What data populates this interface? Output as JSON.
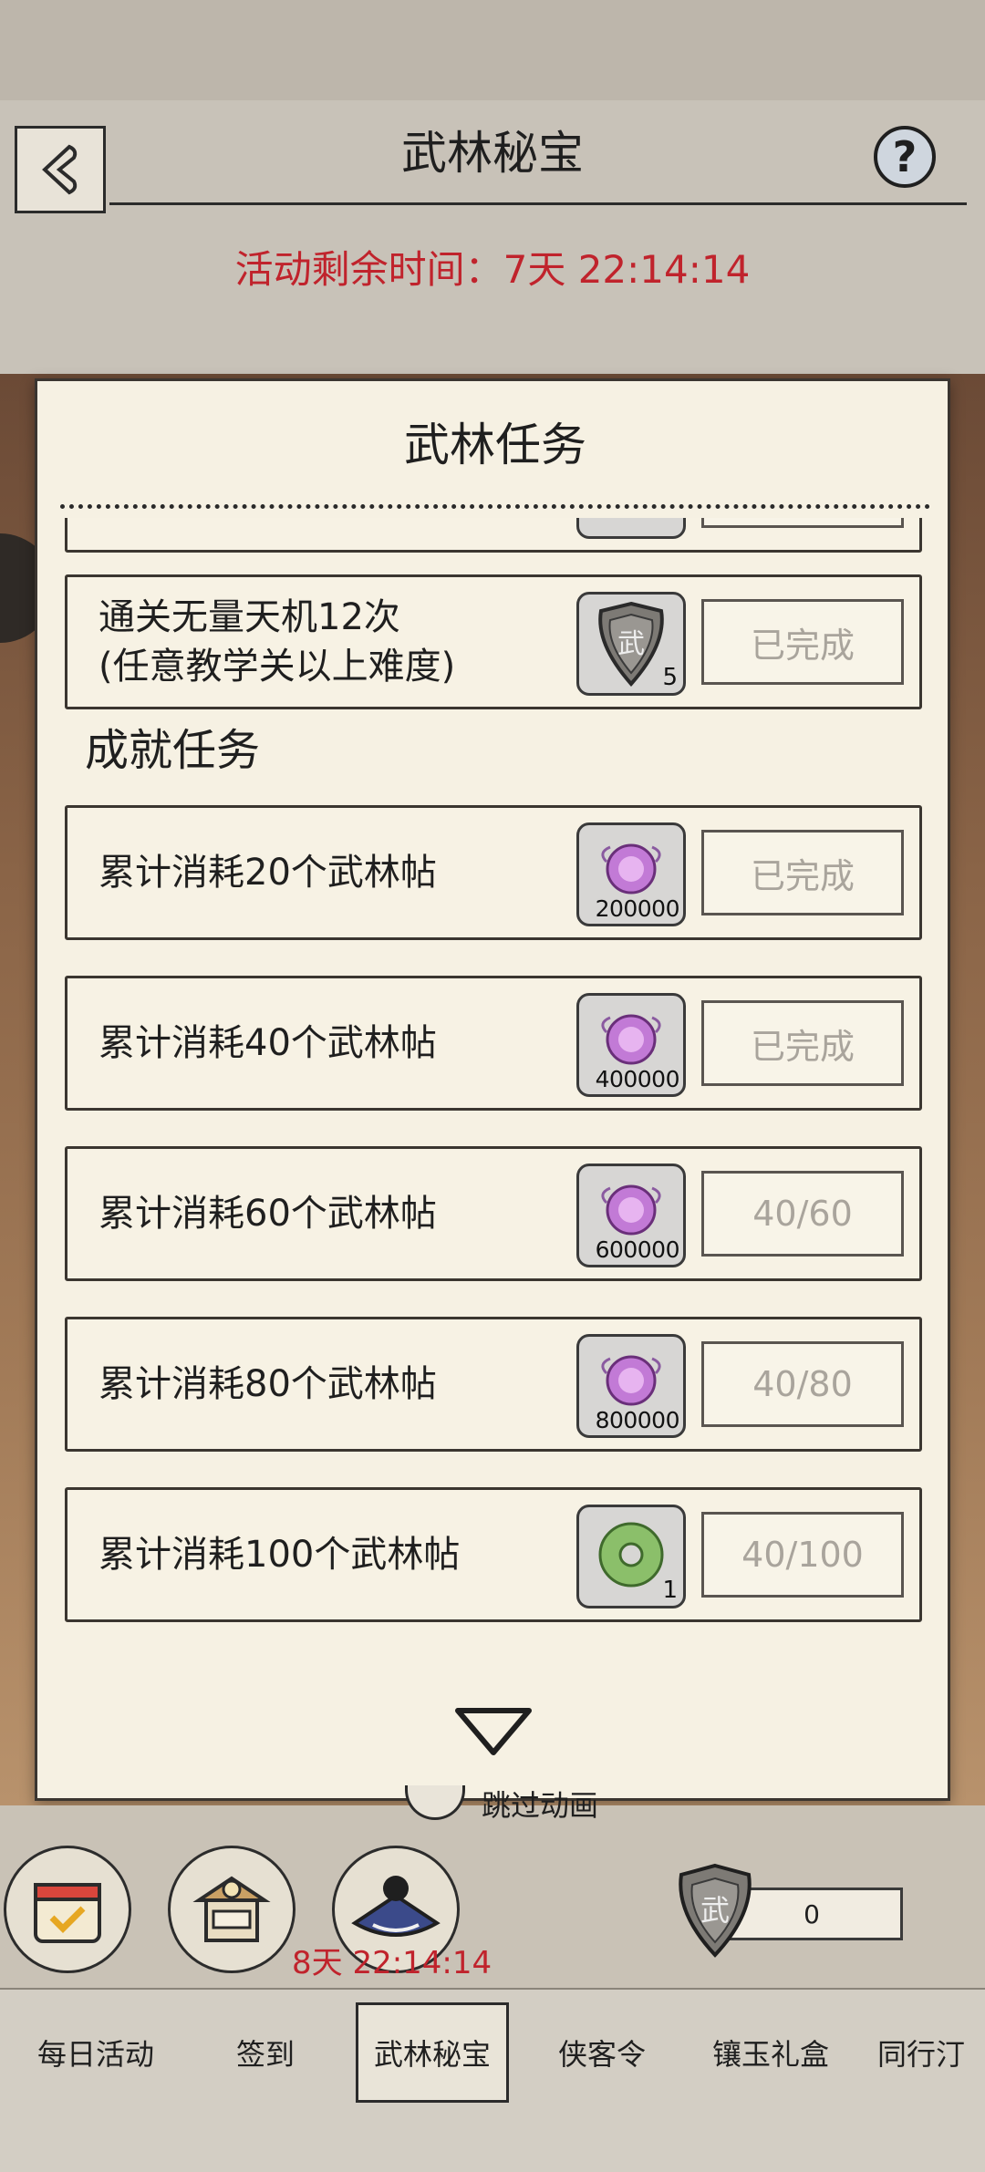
{
  "header": {
    "title": "武林秘宝",
    "timer_text": "活动剩余时间：7天 22:14:14",
    "help_label": "?"
  },
  "panel": {
    "title": "武林任务",
    "daily_tasks": [
      {
        "desc_line1": "通关无量天机12次",
        "desc_line2": "(任意教学关以上难度)",
        "reward_icon": "wu-shield-token",
        "reward_count": "5",
        "status": "已完成"
      }
    ],
    "achievement_section_title": "成就任务",
    "achievement_tasks": [
      {
        "desc": "累计消耗20个武林帖",
        "reward_icon": "purple-orb",
        "reward_count": "200000",
        "status": "已完成"
      },
      {
        "desc": "累计消耗40个武林帖",
        "reward_icon": "purple-orb",
        "reward_count": "400000",
        "status": "已完成"
      },
      {
        "desc": "累计消耗60个武林帖",
        "reward_icon": "purple-orb",
        "reward_count": "600000",
        "status": "40/60"
      },
      {
        "desc": "累计消耗80个武林帖",
        "reward_icon": "purple-orb",
        "reward_count": "800000",
        "status": "40/80"
      },
      {
        "desc": "累计消耗100个武林帖",
        "reward_icon": "jade-disc",
        "reward_count": "1",
        "status": "40/100"
      }
    ]
  },
  "under_panel": {
    "skip_animation_label": "跳过动画",
    "event_timer": "8天 22:14:14",
    "currency_value": "0",
    "buttons": [
      "calendar-icon",
      "shop-icon",
      "character-icon"
    ]
  },
  "tabs": [
    {
      "label": "每日活动",
      "active": false
    },
    {
      "label": "签到",
      "active": false
    },
    {
      "label": "武林秘宝",
      "active": true
    },
    {
      "label": "侠客令",
      "active": false
    },
    {
      "label": "镶玉礼盒",
      "active": false
    },
    {
      "label": "同行汀",
      "active": false
    }
  ],
  "colors": {
    "accent_red": "#c0232c",
    "panel_bg": "#f6f1e3",
    "status_text": "#a9a49c"
  }
}
